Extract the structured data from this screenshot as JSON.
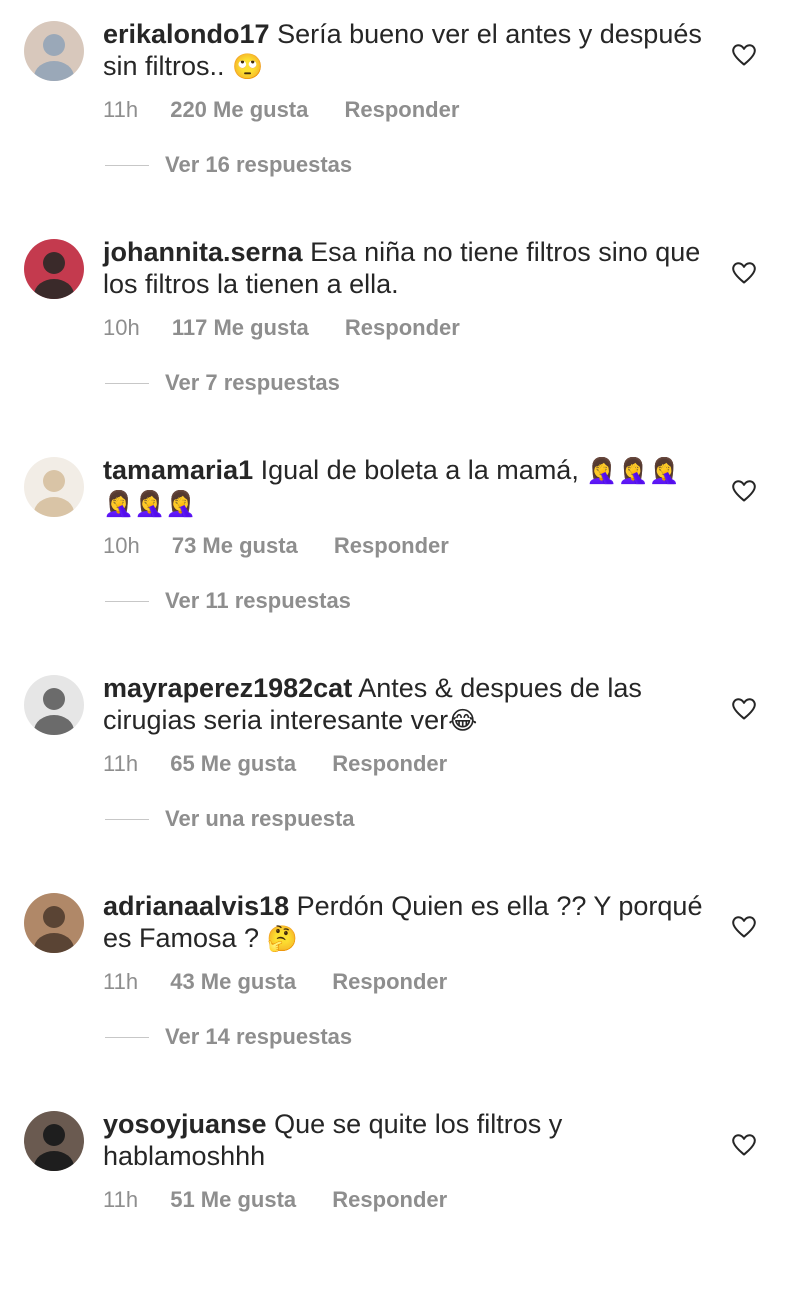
{
  "comments": [
    {
      "username": "erikalondo17",
      "text": "Sería bueno ver el antes y después sin filtros.. ",
      "emoji": "🙄",
      "time": "11h",
      "likes": "220 Me gusta",
      "reply_label": "Responder",
      "replies_label": "Ver 16 respuestas",
      "avatar_colors": [
        "#9aa8b8",
        "#d8c8bc"
      ]
    },
    {
      "username": "johannita.serna",
      "text": "Esa niña no tiene filtros sino que los filtros la tienen a ella.",
      "emoji": "",
      "time": "10h",
      "likes": "117 Me gusta",
      "reply_label": "Responder",
      "replies_label": "Ver 7 respuestas",
      "avatar_colors": [
        "#3a2a2a",
        "#c43a4e"
      ]
    },
    {
      "username": "tamamaria1",
      "text": "Igual de boleta a la mamá, ",
      "emoji": "🤦‍♀️🤦‍♀️🤦‍♀️🤦‍♀️🤦‍♀️🤦‍♀️",
      "time": "10h",
      "likes": "73 Me gusta",
      "reply_label": "Responder",
      "replies_label": "Ver 11 respuestas",
      "avatar_colors": [
        "#d9c4a6",
        "#f2ede6"
      ]
    },
    {
      "username": "mayraperez1982cat",
      "text": "Antes & despues de las cirugias seria interesante ver",
      "emoji": "😂",
      "time": "11h",
      "likes": "65 Me gusta",
      "reply_label": "Responder",
      "replies_label": "Ver una respuesta",
      "avatar_colors": [
        "#6b6b6b",
        "#e6e6e6"
      ]
    },
    {
      "username": "adrianaalvis18",
      "text": "Perdón Quien es ella ?? Y porqué es Famosa ? ",
      "emoji": "🤔",
      "time": "11h",
      "likes": "43 Me gusta",
      "reply_label": "Responder",
      "replies_label": "Ver 14 respuestas",
      "avatar_colors": [
        "#5a4434",
        "#b08868"
      ]
    },
    {
      "username": "yosoyjuanse",
      "text": "Que se quite los filtros y hablamoshhh",
      "emoji": "",
      "time": "11h",
      "likes": "51 Me gusta",
      "reply_label": "Responder",
      "replies_label": "",
      "avatar_colors": [
        "#1e1e1e",
        "#6a5a50"
      ]
    }
  ],
  "icons": {
    "like": "heart-outline-icon"
  },
  "colors": {
    "text": "#262626",
    "secondary": "#8e8e8e",
    "divider": "#c7c7c7"
  }
}
